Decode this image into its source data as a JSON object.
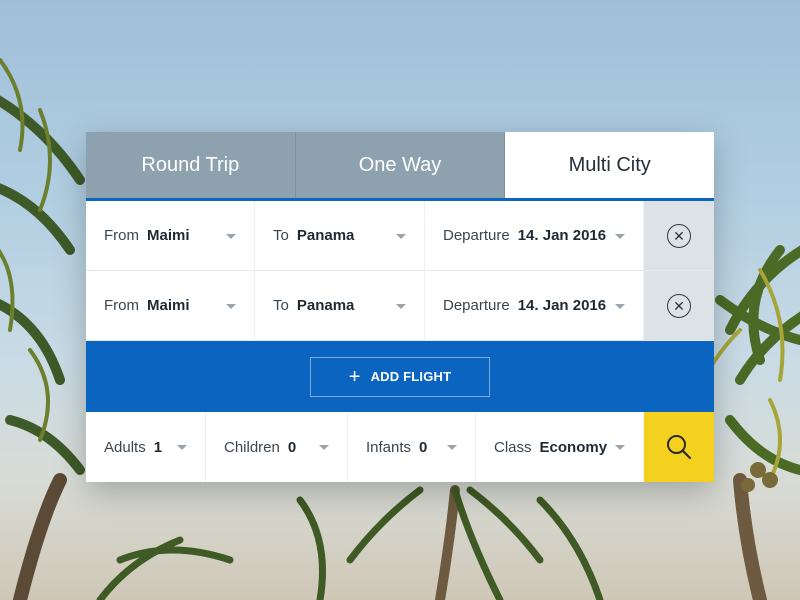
{
  "tabs": [
    {
      "label": "Round Trip",
      "active": false
    },
    {
      "label": "One Way",
      "active": false
    },
    {
      "label": "Multi City",
      "active": true
    }
  ],
  "flights": [
    {
      "from_label": "From",
      "from_value": "Maimi",
      "to_label": "To",
      "to_value": "Panama",
      "departure_label": "Departure",
      "departure_value": "14. Jan 2016"
    },
    {
      "from_label": "From",
      "from_value": "Maimi",
      "to_label": "To",
      "to_value": "Panama",
      "departure_label": "Departure",
      "departure_value": "14. Jan 2016"
    }
  ],
  "add_flight": {
    "label": "ADD FLIGHT"
  },
  "passengers": {
    "adults_label": "Adults",
    "adults_value": "1",
    "children_label": "Children",
    "children_value": "0",
    "infants_label": "Infants",
    "infants_value": "0",
    "class_label": "Class",
    "class_value": "Economy"
  },
  "colors": {
    "accent_blue": "#0a64c0",
    "search_yellow": "#f5d11f",
    "tab_inactive": "#8da1af",
    "remove_bg": "#dde2e6"
  }
}
